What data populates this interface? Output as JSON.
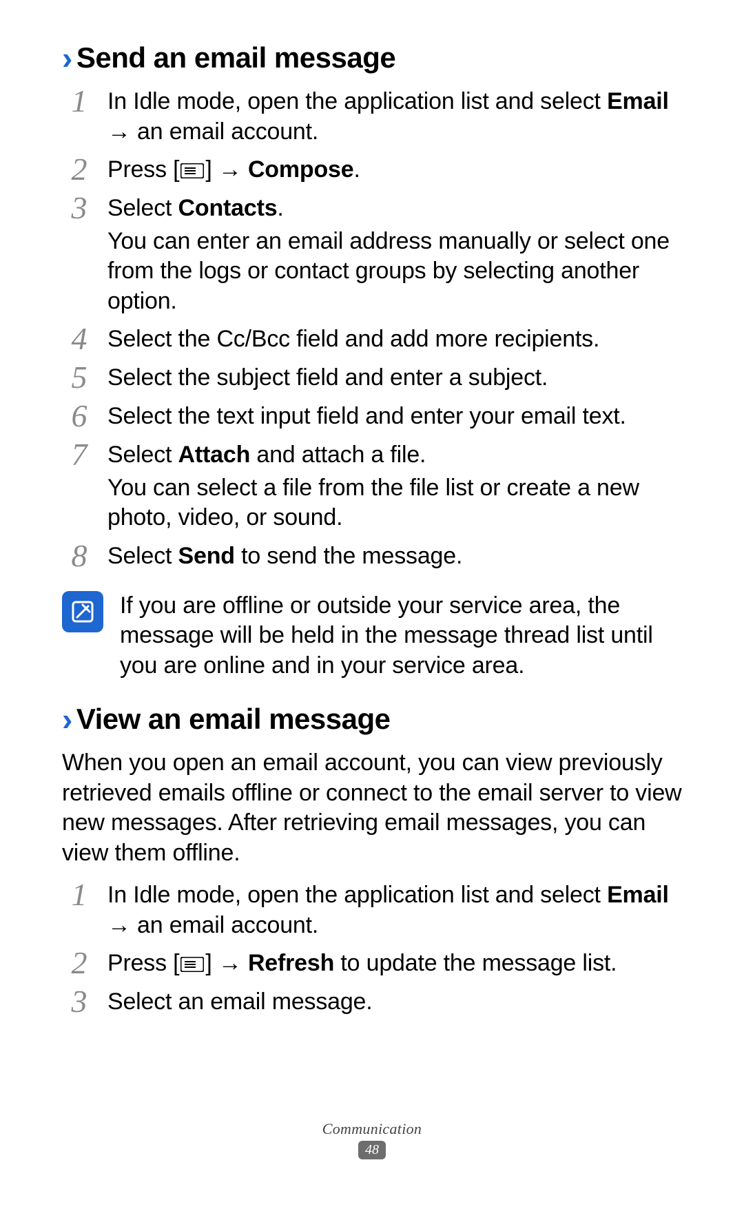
{
  "section1": {
    "title": "Send an email message",
    "steps": [
      {
        "num": "1",
        "segments": [
          {
            "t": "In Idle mode, open the application list and select "
          },
          {
            "t": "Email",
            "bold": true
          },
          {
            "t": " → an email account."
          }
        ]
      },
      {
        "num": "2",
        "segments": [
          {
            "t": "Press ["
          },
          {
            "icon": "menu"
          },
          {
            "t": "] → "
          },
          {
            "t": "Compose",
            "bold": true
          },
          {
            "t": "."
          }
        ]
      },
      {
        "num": "3",
        "segments": [
          {
            "t": "Select "
          },
          {
            "t": "Contacts",
            "bold": true
          },
          {
            "t": "."
          }
        ],
        "extra": "You can enter an email address manually or select one from the logs or contact groups by selecting another option."
      },
      {
        "num": "4",
        "segments": [
          {
            "t": "Select the Cc/Bcc field and add more recipients."
          }
        ]
      },
      {
        "num": "5",
        "segments": [
          {
            "t": "Select the subject field and enter a subject."
          }
        ]
      },
      {
        "num": "6",
        "segments": [
          {
            "t": "Select the text input field and enter your email text."
          }
        ]
      },
      {
        "num": "7",
        "segments": [
          {
            "t": "Select "
          },
          {
            "t": "Attach",
            "bold": true
          },
          {
            "t": " and attach a file."
          }
        ],
        "extra": "You can select a file from the file list or create a new photo, video, or sound."
      },
      {
        "num": "8",
        "segments": [
          {
            "t": "Select "
          },
          {
            "t": "Send",
            "bold": true
          },
          {
            "t": " to send the message."
          }
        ]
      }
    ],
    "note": "If you are offline or outside your service area, the message will be held in the message thread list until you are online and in your service area."
  },
  "section2": {
    "title": "View an email message",
    "intro": "When you open an email account, you can view previously retrieved emails offline or connect to the email server to view new messages. After retrieving email messages, you can view them offline.",
    "steps": [
      {
        "num": "1",
        "segments": [
          {
            "t": "In Idle mode, open the application list and select "
          },
          {
            "t": "Email",
            "bold": true
          },
          {
            "t": " → an email account."
          }
        ]
      },
      {
        "num": "2",
        "segments": [
          {
            "t": "Press ["
          },
          {
            "icon": "menu"
          },
          {
            "t": "] → "
          },
          {
            "t": "Refresh",
            "bold": true
          },
          {
            "t": " to update the message list."
          }
        ]
      },
      {
        "num": "3",
        "segments": [
          {
            "t": "Select an email message."
          }
        ]
      }
    ]
  },
  "footer": {
    "label": "Communication",
    "page": "48"
  }
}
